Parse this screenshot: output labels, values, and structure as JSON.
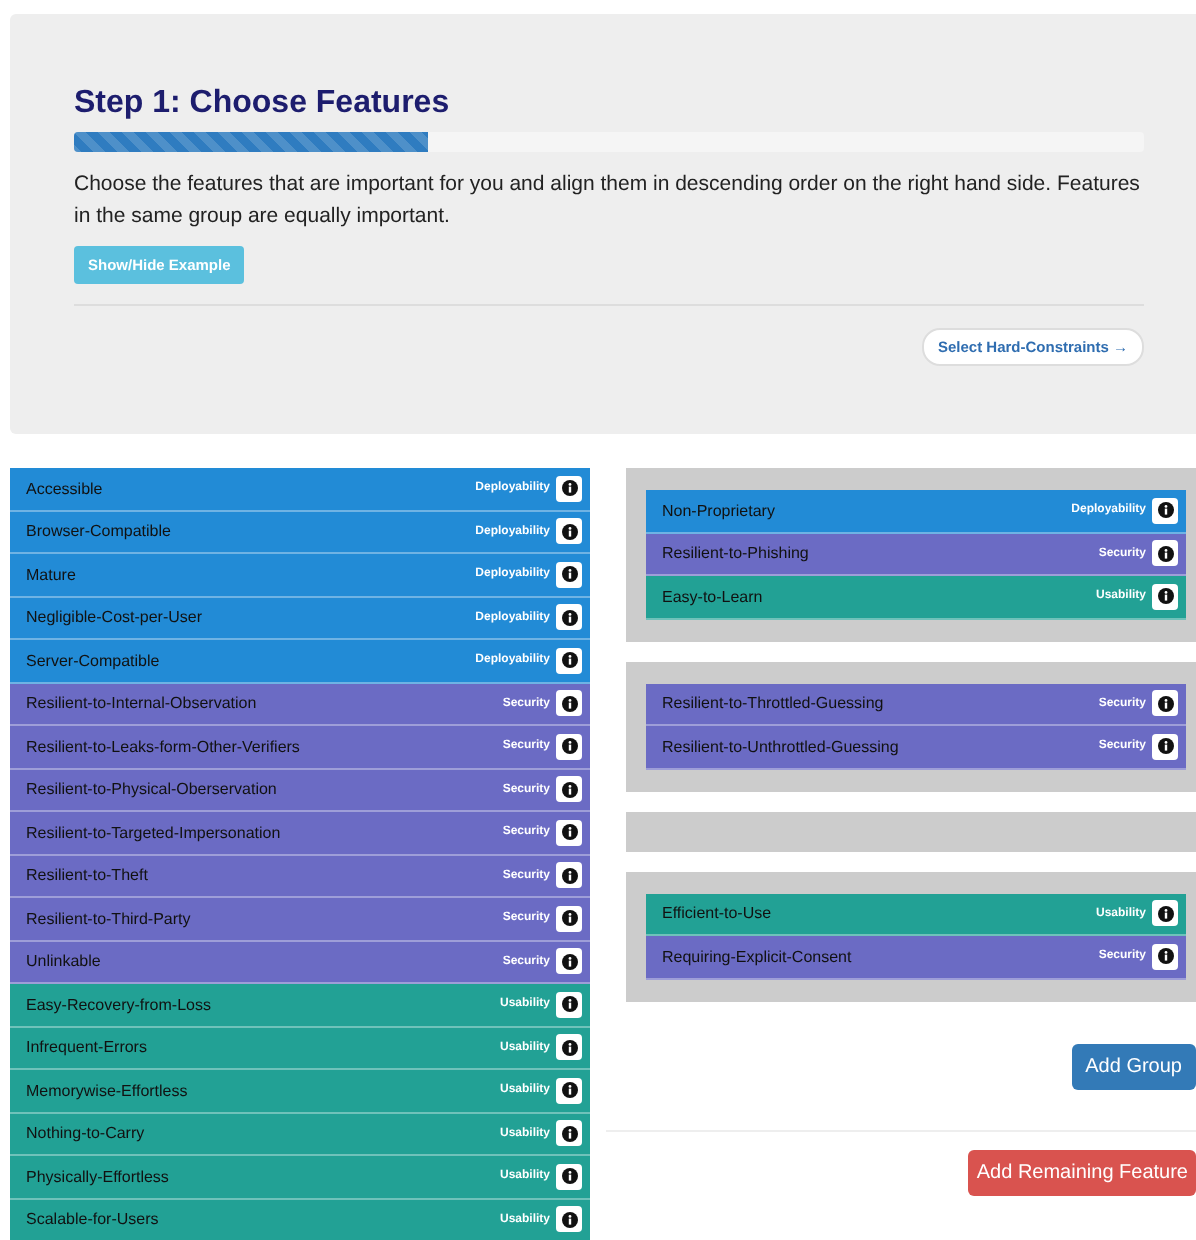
{
  "header": {
    "title": "Step 1: Choose Features",
    "progress": {
      "level": 0.33
    },
    "description": "Choose the features that are important for you and align them in descending order on the right hand side. Features in the same group are equally important.",
    "example_button": "Show/Hide Example",
    "next_button": "Select Hard-Constraints →"
  },
  "available_features": [
    {
      "name": "Accessible",
      "category": "Deployability",
      "color": "#228bd6"
    },
    {
      "name": "Browser-Compatible",
      "category": "Deployability",
      "color": "#228bd6"
    },
    {
      "name": "Mature",
      "category": "Deployability",
      "color": "#228bd6"
    },
    {
      "name": "Negligible-Cost-per-User",
      "category": "Deployability",
      "color": "#228bd6"
    },
    {
      "name": "Server-Compatible",
      "category": "Deployability",
      "color": "#228bd6"
    },
    {
      "name": "Resilient-to-Internal-Observation",
      "category": "Security",
      "color": "#6b6bc4"
    },
    {
      "name": "Resilient-to-Leaks-form-Other-Verifiers",
      "category": "Security",
      "color": "#6b6bc4"
    },
    {
      "name": "Resilient-to-Physical-Oberservation",
      "category": "Security",
      "color": "#6b6bc4"
    },
    {
      "name": "Resilient-to-Targeted-Impersonation",
      "category": "Security",
      "color": "#6b6bc4"
    },
    {
      "name": "Resilient-to-Theft",
      "category": "Security",
      "color": "#6b6bc4"
    },
    {
      "name": "Resilient-to-Third-Party",
      "category": "Security",
      "color": "#6b6bc4"
    },
    {
      "name": "Unlinkable",
      "category": "Security",
      "color": "#6b6bc4"
    },
    {
      "name": "Easy-Recovery-from-Loss",
      "category": "Usability",
      "color": "#22a195"
    },
    {
      "name": "Infrequent-Errors",
      "category": "Usability",
      "color": "#22a195"
    },
    {
      "name": "Memorywise-Effortless",
      "category": "Usability",
      "color": "#22a195"
    },
    {
      "name": "Nothing-to-Carry",
      "category": "Usability",
      "color": "#22a195"
    },
    {
      "name": "Physically-Effortless",
      "category": "Usability",
      "color": "#22a195"
    },
    {
      "name": "Scalable-for-Users",
      "category": "Usability",
      "color": "#22a195"
    }
  ],
  "groups": [
    {
      "empty": false,
      "features": [
        {
          "name": "Non-Proprietary",
          "category": "Deployability",
          "color": "#228bd6"
        },
        {
          "name": "Resilient-to-Phishing",
          "category": "Security",
          "color": "#6b6bc4"
        },
        {
          "name": "Easy-to-Learn",
          "category": "Usability",
          "color": "#22a195"
        }
      ]
    },
    {
      "empty": false,
      "features": [
        {
          "name": "Resilient-to-Throttled-Guessing",
          "category": "Security",
          "color": "#6b6bc4"
        },
        {
          "name": "Resilient-to-Unthrottled-Guessing",
          "category": "Security",
          "color": "#6b6bc4"
        }
      ]
    },
    {
      "empty": true
    },
    {
      "empty": false,
      "features": [
        {
          "name": "Efficient-to-Use",
          "category": "Usability",
          "color": "#22a195"
        },
        {
          "name": "Requiring-Explicit-Consent",
          "category": "Security",
          "color": "#6b6bc4"
        }
      ]
    }
  ],
  "add_group_button": "Add Group",
  "add_remaining_button": "Add Remaining Feature"
}
